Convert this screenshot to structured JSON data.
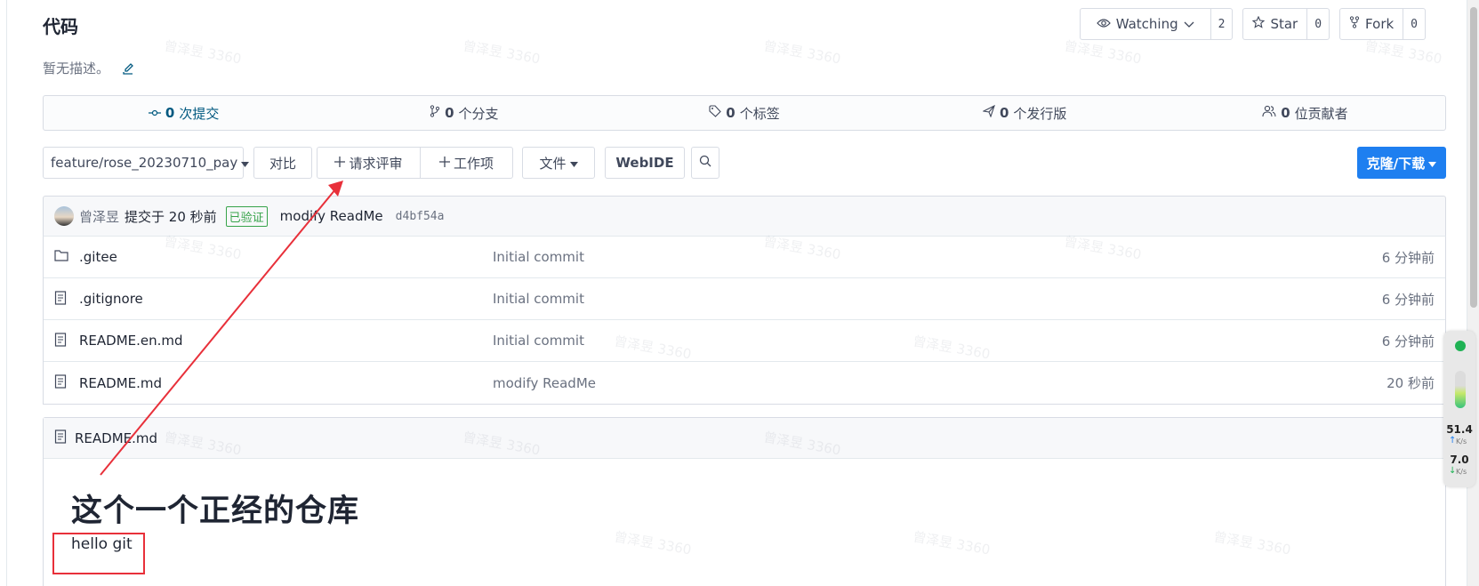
{
  "repo": {
    "title": "代码",
    "description": "暂无描述。"
  },
  "actions": {
    "watch_label": "Watching",
    "watch_count": "2",
    "star_label": "Star",
    "star_count": "0",
    "fork_label": "Fork",
    "fork_count": "0"
  },
  "stats": [
    {
      "value": "0",
      "label": "次提交"
    },
    {
      "value": "0",
      "label": "个分支"
    },
    {
      "value": "0",
      "label": "个标签"
    },
    {
      "value": "0",
      "label": "个发行版"
    },
    {
      "value": "0",
      "label": "位贡献者"
    }
  ],
  "toolbar": {
    "branch": "feature/rose_20230710_pay",
    "compare": "对比",
    "pull_request": "请求评审",
    "issue": "工作项",
    "files": "文件",
    "webide": "WebIDE",
    "clone": "克隆/下载"
  },
  "commit": {
    "author": "曾泽昱",
    "time": "提交于 20 秒前",
    "verified": "已验证",
    "message": "modify ReadMe",
    "sha": "d4bf54a"
  },
  "files": [
    {
      "name": ".gitee",
      "type": "folder",
      "message": "Initial commit",
      "time": "6 分钟前"
    },
    {
      "name": ".gitignore",
      "type": "file",
      "message": "Initial commit",
      "time": "6 分钟前"
    },
    {
      "name": "README.en.md",
      "type": "file",
      "message": "Initial commit",
      "time": "6 分钟前"
    },
    {
      "name": "README.md",
      "type": "file",
      "message": "modify ReadMe",
      "time": "20 秒前"
    }
  ],
  "readme": {
    "filename": "README.md",
    "heading": "这个一个正经的仓库",
    "paragraph": "hello git"
  },
  "watermark": "曾泽昱 3360",
  "net_widget": {
    "upload_value": "51.4",
    "upload_unit": "K/s",
    "download_value": "7.0",
    "download_unit": "K/s"
  },
  "colors": {
    "accent": "#1e7ff0",
    "annotation_red": "#e8303a",
    "verified_green": "#37a34a"
  }
}
